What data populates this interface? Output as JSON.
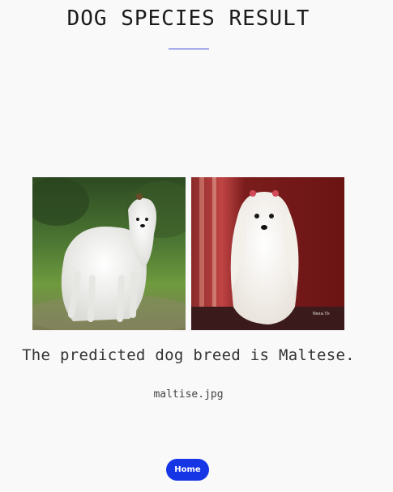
{
  "header": {
    "title": "DOG SPECIES RESULT"
  },
  "gallery": {
    "images": [
      {
        "name": "maltese-photo-outdoor",
        "icon": "dog-photo"
      },
      {
        "name": "maltese-photo-studio",
        "icon": "dog-photo"
      }
    ]
  },
  "result": {
    "prediction_text": "The predicted dog breed is Maltese.",
    "file_name": "maltise.jpg"
  },
  "nav": {
    "home_label": "Home"
  },
  "colors": {
    "accent": "#1636e6",
    "underline": "#3b4fe0",
    "background": "#f9f9f9"
  }
}
